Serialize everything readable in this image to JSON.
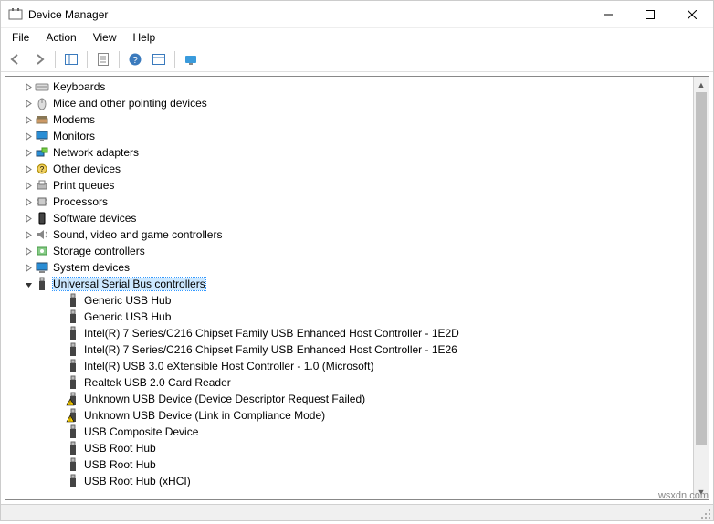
{
  "window": {
    "title": "Device Manager"
  },
  "menu": {
    "file": "File",
    "action": "Action",
    "view": "View",
    "help": "Help"
  },
  "tree": {
    "categories": [
      {
        "label": "Keyboards",
        "icon": "keyboard-icon",
        "expanded": false
      },
      {
        "label": "Mice and other pointing devices",
        "icon": "mouse-icon",
        "expanded": false
      },
      {
        "label": "Modems",
        "icon": "modem-icon",
        "expanded": false
      },
      {
        "label": "Monitors",
        "icon": "monitor-icon",
        "expanded": false
      },
      {
        "label": "Network adapters",
        "icon": "network-icon",
        "expanded": false
      },
      {
        "label": "Other devices",
        "icon": "other-icon",
        "expanded": false
      },
      {
        "label": "Print queues",
        "icon": "printer-icon",
        "expanded": false
      },
      {
        "label": "Processors",
        "icon": "processor-icon",
        "expanded": false
      },
      {
        "label": "Software devices",
        "icon": "software-icon",
        "expanded": false
      },
      {
        "label": "Sound, video and game controllers",
        "icon": "sound-icon",
        "expanded": false
      },
      {
        "label": "Storage controllers",
        "icon": "storage-icon",
        "expanded": false
      },
      {
        "label": "System devices",
        "icon": "system-icon",
        "expanded": false
      },
      {
        "label": "Universal Serial Bus controllers",
        "icon": "usb-icon",
        "expanded": true,
        "selected": true,
        "children": [
          {
            "label": "Generic USB Hub",
            "icon": "usb-icon",
            "warn": false
          },
          {
            "label": "Generic USB Hub",
            "icon": "usb-icon",
            "warn": false
          },
          {
            "label": "Intel(R) 7 Series/C216 Chipset Family USB Enhanced Host Controller - 1E2D",
            "icon": "usb-icon",
            "warn": false
          },
          {
            "label": "Intel(R) 7 Series/C216 Chipset Family USB Enhanced Host Controller - 1E26",
            "icon": "usb-icon",
            "warn": false
          },
          {
            "label": "Intel(R) USB 3.0 eXtensible Host Controller - 1.0 (Microsoft)",
            "icon": "usb-icon",
            "warn": false
          },
          {
            "label": "Realtek USB 2.0 Card Reader",
            "icon": "usb-icon",
            "warn": false
          },
          {
            "label": "Unknown USB Device (Device Descriptor Request Failed)",
            "icon": "usb-icon",
            "warn": true
          },
          {
            "label": "Unknown USB Device (Link in Compliance Mode)",
            "icon": "usb-icon",
            "warn": true
          },
          {
            "label": "USB Composite Device",
            "icon": "usb-icon",
            "warn": false
          },
          {
            "label": "USB Root Hub",
            "icon": "usb-icon",
            "warn": false
          },
          {
            "label": "USB Root Hub",
            "icon": "usb-icon",
            "warn": false
          },
          {
            "label": "USB Root Hub (xHCI)",
            "icon": "usb-icon",
            "warn": false
          }
        ]
      }
    ]
  },
  "watermark": "wsxdn.com"
}
